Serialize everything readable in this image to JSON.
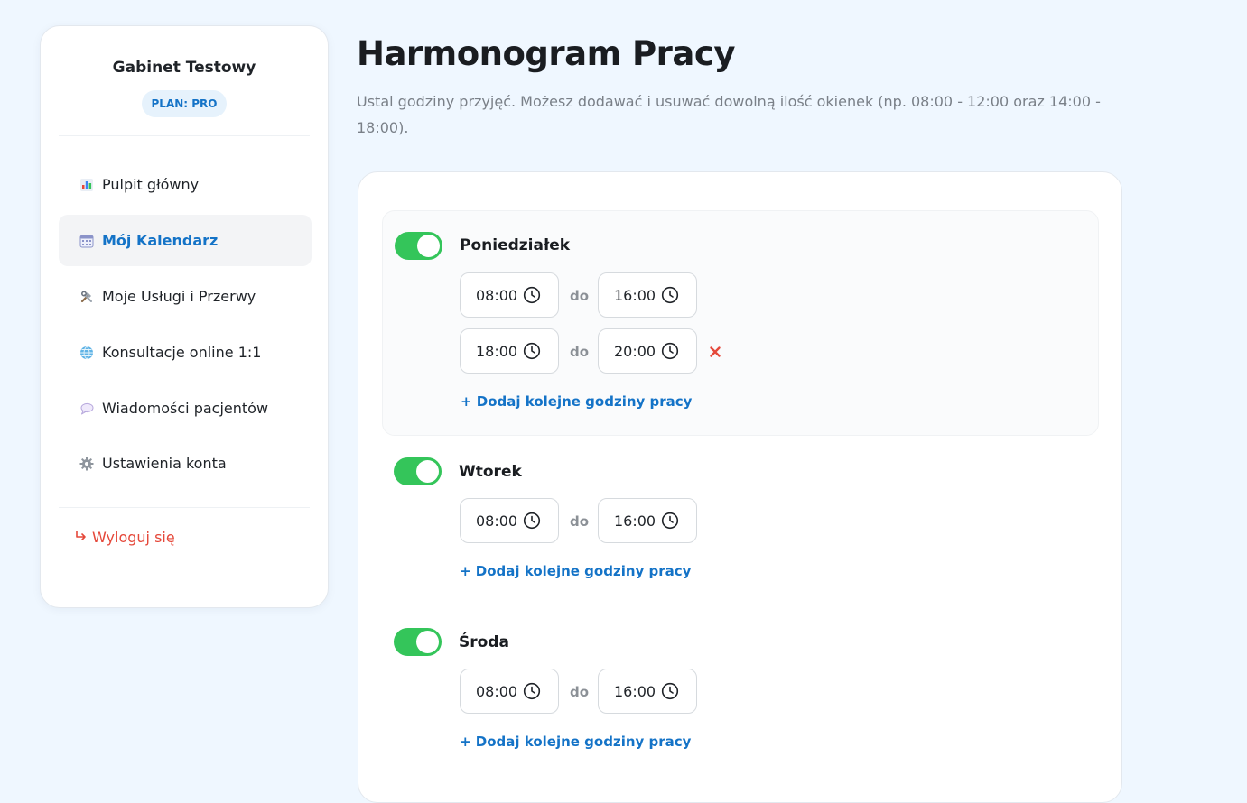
{
  "sidebar": {
    "clinic_name": "Gabinet Testowy",
    "plan_badge": "PLAN: PRO",
    "nav": [
      {
        "label": "Pulpit główny",
        "icon": "bar-chart-icon",
        "active": false
      },
      {
        "label": "Mój Kalendarz",
        "icon": "calendar-icon",
        "active": true
      },
      {
        "label": "Moje Usługi i Przerwy",
        "icon": "tools-icon",
        "active": false
      },
      {
        "label": "Konsultacje online 1:1",
        "icon": "globe-icon",
        "active": false
      },
      {
        "label": "Wiadomości pacjentów",
        "icon": "speech-bubble-icon",
        "active": false
      },
      {
        "label": "Ustawienia konta",
        "icon": "gear-icon",
        "active": false
      }
    ],
    "logout_label": "Wyloguj się"
  },
  "page": {
    "title": "Harmonogram Pracy",
    "description": "Ustal godziny przyjęć. Możesz dodawać i usuwać dowolną ilość okienek (np. 08:00 - 12:00 oraz 14:00 - 18:00)."
  },
  "schedule": {
    "separator": "do",
    "add_label": "+ Dodaj kolejne godziny pracy",
    "days": [
      {
        "name": "Poniedziałek",
        "enabled": true,
        "slots": [
          {
            "from": "08:00",
            "to": "16:00"
          },
          {
            "from": "18:00",
            "to": "20:00",
            "removable": true
          }
        ]
      },
      {
        "name": "Wtorek",
        "enabled": true,
        "slots": [
          {
            "from": "08:00",
            "to": "16:00"
          }
        ]
      },
      {
        "name": "Środa",
        "enabled": true,
        "slots": [
          {
            "from": "08:00",
            "to": "16:00"
          }
        ]
      }
    ]
  },
  "colors": {
    "accent": "#1473c7",
    "toggle_on": "#34c55a",
    "danger": "#e5483a",
    "background": "#eff7ff"
  }
}
